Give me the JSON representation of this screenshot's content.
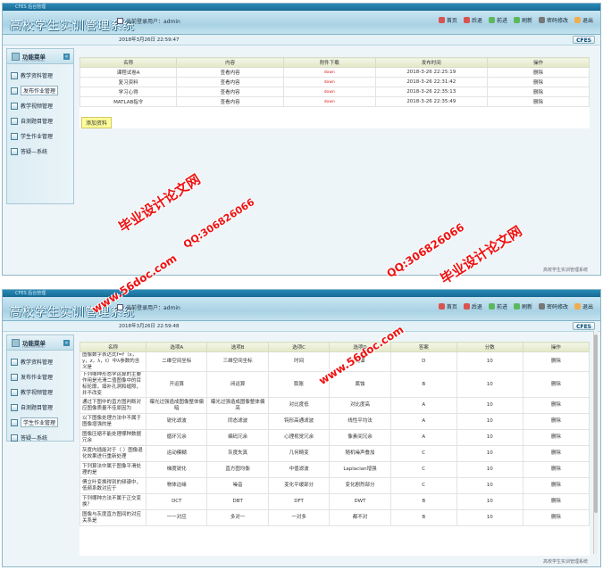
{
  "window_title": "CFES 后台管理",
  "app_title": "高校学生实训管理系统",
  "user_label": "当前登录用户：admin",
  "toolbar": [
    {
      "label": "首页",
      "icon": "home-icon",
      "color": "#d9534f"
    },
    {
      "label": "后退",
      "icon": "back-icon",
      "color": "#d9534f"
    },
    {
      "label": "前进",
      "icon": "forward-icon",
      "color": "#5cb85c"
    },
    {
      "label": "刷新",
      "icon": "refresh-icon",
      "color": "#5cb85c"
    },
    {
      "label": "密码修改",
      "icon": "key-icon",
      "color": "#777777"
    },
    {
      "label": "退出",
      "icon": "exit-icon",
      "color": "#f0ad4e"
    }
  ],
  "logo": "CFES",
  "sidebar": {
    "title": "功能菜单",
    "subtitle": "FUNCTION MENU",
    "toggle": "«",
    "items": [
      {
        "label": "教学资料管理"
      },
      {
        "label": "发布作业管理"
      },
      {
        "label": "教学视频管理"
      },
      {
        "label": "自测题目管理"
      },
      {
        "label": "学生作业管理"
      },
      {
        "label": "答疑—系统"
      }
    ]
  },
  "footer": "高校学生实训管理系统",
  "screen1": {
    "date": "2018年3月26日   22:59:47",
    "columns": [
      "名称",
      "内容",
      "附件下载",
      "发布时间",
      "操作"
    ],
    "rows": [
      {
        "name": "课程试卷A",
        "content": "查看内容",
        "download": "down",
        "time": "2018-3-26 22:25:19",
        "action": "删除"
      },
      {
        "name": "复习资料",
        "content": "查看内容",
        "download": "down",
        "time": "2018-3-26 22:31:42",
        "action": "删除"
      },
      {
        "name": "学习心得",
        "content": "查看内容",
        "download": "down",
        "time": "2018-3-26 22:35:13",
        "action": "删除"
      },
      {
        "name": "MATLAB指令",
        "content": "查看内容",
        "download": "down",
        "time": "2018-3-26 22:35:49",
        "action": "删除"
      }
    ],
    "add_button": "添加资料"
  },
  "screen2": {
    "date": "2018年3月26日   22:59:48",
    "columns": [
      "名称",
      "选项A",
      "选项B",
      "选项C",
      "选项D",
      "答案",
      "分数",
      "操作"
    ],
    "rows": [
      {
        "q": "图像数字表达式f=f（x，y，z，λ，t）中λ参数的含义是",
        "a": "二维空间坐标",
        "b": "三维空间坐标",
        "c": "时间",
        "d": "光谱",
        "ans": "D",
        "score": "10",
        "op": "删除"
      },
      {
        "q": "下列哪种形态学运算的主要作用是光滑二值图像中的目标轮廓，填补孔洞和缝隙，并不改变",
        "a": "开运算",
        "b": "闭运算",
        "c": "膨胀",
        "d": "腐蚀",
        "ans": "B",
        "score": "10",
        "op": "删除"
      },
      {
        "q": "通过下图中的直方图判断对应图像质量不佳原因为",
        "a": "曝光过强造成图像整体偏暗",
        "b": "曝光过强造成图像整体偏亮",
        "c": "对比度低",
        "d": "对比度高",
        "ans": "A",
        "score": "10",
        "op": "删除"
      },
      {
        "q": "以下图像处理方法中不属于图像增强的是",
        "a": "锐化滤波",
        "b": "同态滤波",
        "c": "钝形高通滤波",
        "d": "线性平均法",
        "ans": "A",
        "score": "10",
        "op": "删除"
      },
      {
        "q": "图像压缩不能处理哪种数据冗余",
        "a": "循环冗余",
        "b": "编码冗余",
        "c": "心理视觉冗余",
        "d": "像素间冗余",
        "ans": "A",
        "score": "10",
        "op": "删除"
      },
      {
        "q": "灰度内插能对于（ ）图像退化效果进行重新处理",
        "a": "运动模糊",
        "b": "灰度失真",
        "c": "几何畸变",
        "d": "随机噪声叠加",
        "ans": "C",
        "score": "10",
        "op": "删除"
      },
      {
        "q": "下列算法中属于图像平滑处理的是",
        "a": "梯度锐化",
        "b": "直方图均衡",
        "c": "中值滤波",
        "d": "Laplacian增强",
        "ans": "C",
        "score": "10",
        "op": "删除"
      },
      {
        "q": "傅立叶变换得到的频谱中，低频系数对应于",
        "a": "物体边缘",
        "b": "噪音",
        "c": "变化平缓部分",
        "d": "变化剧烈部分",
        "ans": "C",
        "score": "10",
        "op": "删除"
      },
      {
        "q": "下列哪种方法不属于正交变换？",
        "a": "DCT",
        "b": "DBT",
        "c": "DFT",
        "d": "DWT",
        "ans": "B",
        "score": "10",
        "op": "删除"
      },
      {
        "q": "图像与灰度直方图间的对应关系是",
        "a": "一一对应",
        "b": "多对一",
        "c": "一对多",
        "d": "都不对",
        "ans": "B",
        "score": "10",
        "op": "删除"
      }
    ]
  },
  "watermarks": {
    "site": "www.56doc.com",
    "slogan": "毕业设计论文网",
    "qq": "QQ:306826066"
  }
}
